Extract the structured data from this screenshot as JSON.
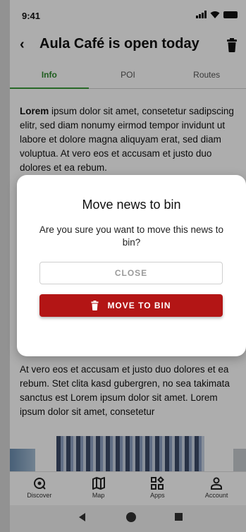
{
  "status": {
    "time": "9:41"
  },
  "header": {
    "title": "Aula Café is open today"
  },
  "tabs": [
    {
      "label": "Info",
      "active": true
    },
    {
      "label": "POI",
      "active": false
    },
    {
      "label": "Routes",
      "active": false
    }
  ],
  "article": {
    "lead_bold": "Lorem",
    "paragraph1_rest": " ipsum dolor sit amet, consetetur sadipscing elitr, sed diam nonumy eirmod tempor invidunt ut labore et dolore magna aliquyam erat, sed diam voluptua. At vero eos et accusam et justo duo dolores et ea rebum.",
    "paragraph2": "At vero eos et accusam et justo duo dolores et ea rebum. Stet clita kasd gubergren, no sea takimata sanctus est Lorem ipsum dolor sit amet. Lorem ipsum dolor sit amet, consetetur"
  },
  "bottom_nav": [
    {
      "label": "Discover",
      "icon": "discover-icon"
    },
    {
      "label": "Map",
      "icon": "map-icon"
    },
    {
      "label": "Apps",
      "icon": "apps-icon"
    },
    {
      "label": "Account",
      "icon": "account-icon"
    }
  ],
  "dialog": {
    "title": "Move news to bin",
    "message": "Are you sure you want to move this news to bin?",
    "close_label": "CLOSE",
    "confirm_label": "MOVE TO BIN"
  },
  "colors": {
    "accent_green": "#3a9a3a",
    "danger_red": "#b31515"
  }
}
